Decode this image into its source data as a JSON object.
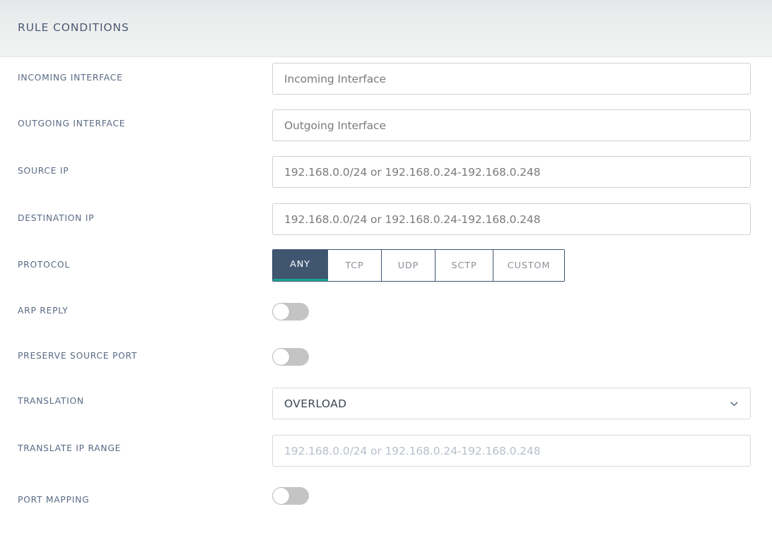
{
  "header": {
    "title": "RULE CONDITIONS"
  },
  "colors": {
    "accent_selected": "#3f5570",
    "accent_teal": "#19a793",
    "label_text": "#5a6a85",
    "placeholder": "#7b7b7b",
    "placeholder_disabled": "#b8bfcc",
    "input_border": "#cfd0d2",
    "toggle_off_track": "#c4c4c4"
  },
  "form": {
    "rows": [
      {
        "label": "INCOMING INTERFACE",
        "type": "text",
        "value": "",
        "placeholder": "Incoming Interface",
        "name": "incoming-interface"
      },
      {
        "label": "OUTGOING INTERFACE",
        "type": "text",
        "value": "",
        "placeholder": "Outgoing Interface",
        "name": "outgoing-interface"
      },
      {
        "label": "SOURCE IP",
        "type": "text",
        "value": "",
        "placeholder": "192.168.0.0/24 or 192.168.0.24-192.168.0.248",
        "name": "source-ip"
      },
      {
        "label": "DESTINATION IP",
        "type": "text",
        "value": "",
        "placeholder": "192.168.0.0/24 or 192.168.0.24-192.168.0.248",
        "name": "destination-ip"
      },
      {
        "label": "PROTOCOL",
        "type": "segmented",
        "name": "protocol",
        "selected": "ANY",
        "options": [
          "ANY",
          "TCP",
          "UDP",
          "SCTP",
          "CUSTOM"
        ]
      },
      {
        "label": "ARP REPLY",
        "type": "toggle",
        "name": "arp-reply",
        "state": "off"
      },
      {
        "label": "PRESERVE SOURCE PORT",
        "type": "toggle",
        "name": "preserve-source-port",
        "state": "off"
      },
      {
        "label": "TRANSLATION",
        "type": "select",
        "name": "translation",
        "value": "OVERLOAD",
        "icon": "chevron-down-icon"
      },
      {
        "label": "TRANSLATE IP RANGE",
        "type": "text-disabled",
        "value": "",
        "placeholder": "192.168.0.0/24 or 192.168.0.24-192.168.0.248",
        "name": "translate-ip-range"
      },
      {
        "label": "PORT MAPPING",
        "type": "toggle",
        "name": "port-mapping",
        "state": "off"
      }
    ]
  }
}
